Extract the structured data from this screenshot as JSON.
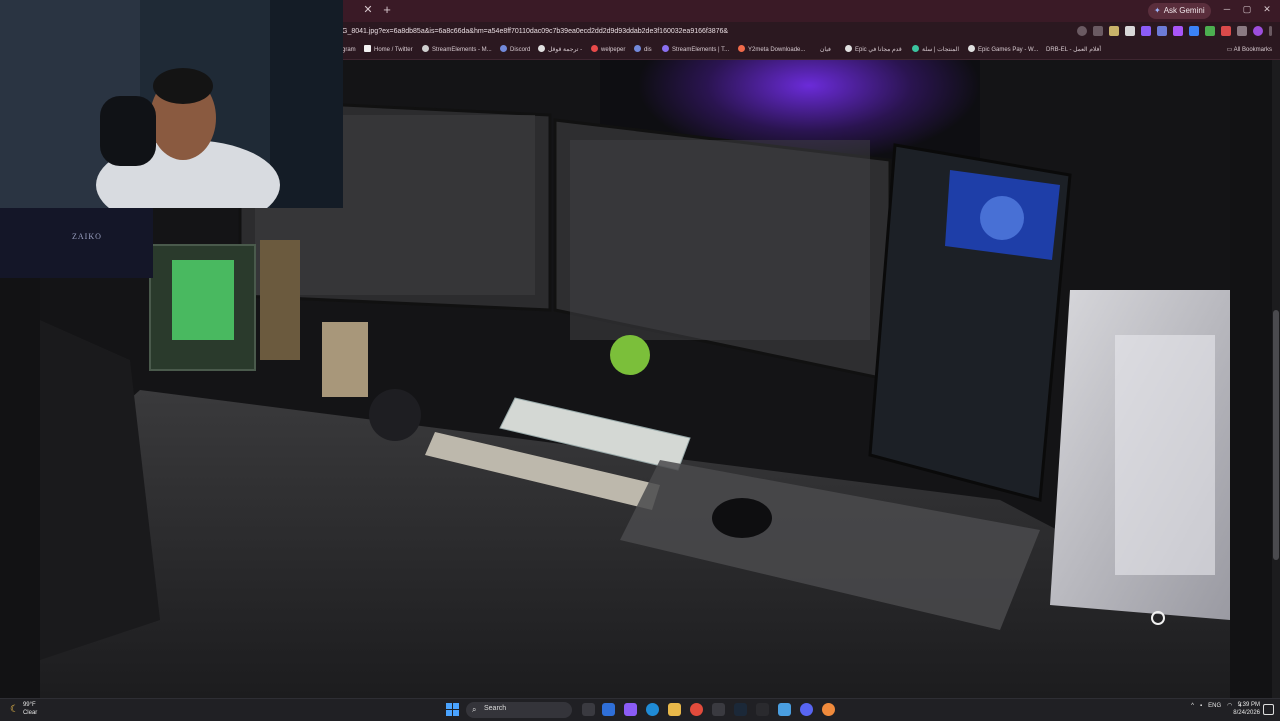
{
  "browser": {
    "url": "G_8041.jpg?ex=6a8db85a&is=6a8c66da&hm=a54e8ff70110dac09c7b39ea0ecd2dd2d9d93ddab2de3f160032ea9166f3876&",
    "ask_gemini_label": "Ask Gemini",
    "all_bookmarks_label": "All Bookmarks",
    "bookmarks": [
      {
        "label": "gram",
        "color": "#d33a7a"
      },
      {
        "label": "Home / Twitter",
        "color": "#f2f2f2"
      },
      {
        "label": "StreamElements - M...",
        "color": "#cfcfcf"
      },
      {
        "label": "Discord",
        "color": "#7289da"
      },
      {
        "label": "ترجمة قوقل -",
        "color": "#e0e0e0"
      },
      {
        "label": "welpeper",
        "color": "#e84a4a"
      },
      {
        "label": "dis",
        "color": "#7289da"
      },
      {
        "label": "StreamElements | T...",
        "color": "#8a6ff0"
      },
      {
        "label": "Y2meta Downloade...",
        "color": "#f06a4a"
      },
      {
        "label": "فيان",
        "color": "#2b1820"
      },
      {
        "label": "Epic قدم مجانا في",
        "color": "#e0e0e0"
      },
      {
        "label": "المنتجات | سلة",
        "color": "#3bc4a0"
      },
      {
        "label": "Epic Games Pay - W...",
        "color": "#e0e0e0"
      },
      {
        "label": "DRB-EL - أفلام العمل",
        "color": "#e0e0e0"
      }
    ]
  },
  "stream_overlay": {
    "nameplate": "ZAIKO"
  },
  "taskbar": {
    "weather_temp": "99°F",
    "weather_cond": "Clear",
    "search_label": "Search",
    "lang": "ENG",
    "time": "9:39 PM",
    "date": "8/24/2026"
  },
  "colors": {
    "accent": "#4aa3ff",
    "tab_bg": "#3a1a26",
    "chrome_bg": "#2b1820"
  }
}
